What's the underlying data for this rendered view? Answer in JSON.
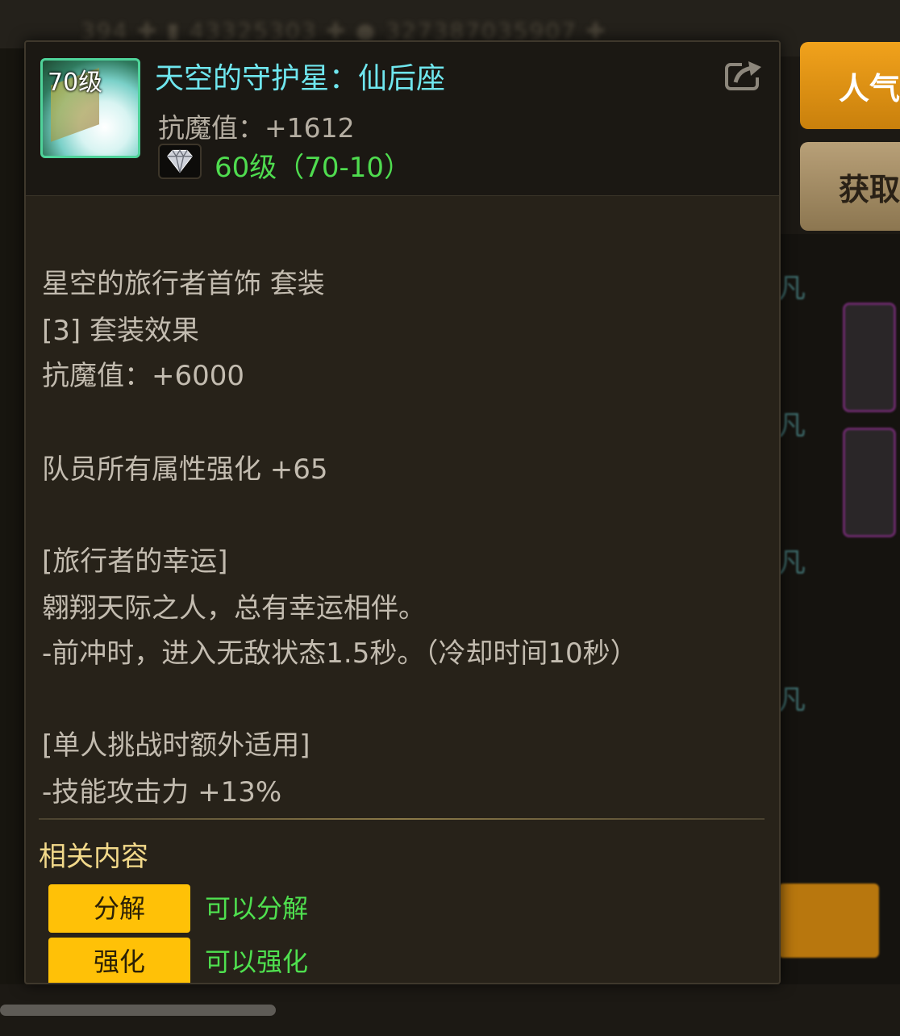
{
  "background": {
    "topbar_text": "394 ✚ ▮ 43325303 ✚ ● 327387035907 ✚",
    "fan_labels": [
      "凡",
      "凡",
      "凡",
      "凡"
    ]
  },
  "side_buttons": {
    "popularity": "人气",
    "obtain": "获取"
  },
  "tooltip": {
    "item": {
      "level_badge": "70级",
      "name": "天空的守护星：仙后座",
      "stat": "抗魔值：+1612",
      "gem_level": "60级（70-10）",
      "icon": "item-icon",
      "share_icon": "share-icon",
      "gem_icon": "diamond-icon"
    },
    "set": {
      "name": "星空的旅行者首饰  套装",
      "effect_header": "[3] 套装效果",
      "bonus_stat": "抗魔值：+6000",
      "party_bonus": "队员所有属性强化 +65",
      "skill_title": "[旅行者的幸运]",
      "skill_flavor": "翱翔天际之人，总有幸运相伴。",
      "skill_effect": "-前冲时，进入无敌状态1.5秒。（冷却时间10秒）",
      "solo_title": "[单人挑战时额外适用]",
      "solo_effect": "-技能攻击力 +13%"
    },
    "related": {
      "title": "相关内容",
      "items": [
        {
          "button": "分解",
          "desc": "可以分解"
        },
        {
          "button": "强化",
          "desc": "可以强化"
        }
      ]
    }
  },
  "colors": {
    "item_name": "#6fe6ee",
    "green": "#4fdc4f",
    "accent_yellow": "#ffc107",
    "related_title": "#f2d98a"
  }
}
